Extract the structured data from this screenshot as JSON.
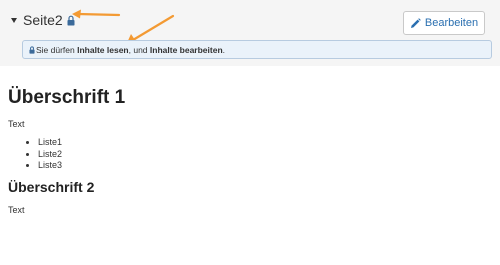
{
  "header": {
    "page_title": "Seite2",
    "edit_button_label": "Bearbeiten"
  },
  "permissions": {
    "prefix": "Sie dürfen ",
    "read": "Inhalte lesen",
    "separator": ", und ",
    "edit": "Inhalte bearbeiten",
    "suffix": "."
  },
  "content": {
    "heading1": "Überschrift 1",
    "paragraph1": "Text",
    "list": [
      "Liste1",
      "Liste2",
      "Liste3"
    ],
    "heading2": "Überschrift 2",
    "paragraph2": "Text"
  },
  "icons": {
    "expand": "caret-down-icon",
    "lock": "lock-icon",
    "edit": "pencil-icon",
    "annotation": "arrow-icon"
  },
  "colors": {
    "accent": "#2a6fb0",
    "annotation_arrow": "#f39a33",
    "info_background": "#eaf2fa",
    "info_border": "#b7cbe0"
  }
}
